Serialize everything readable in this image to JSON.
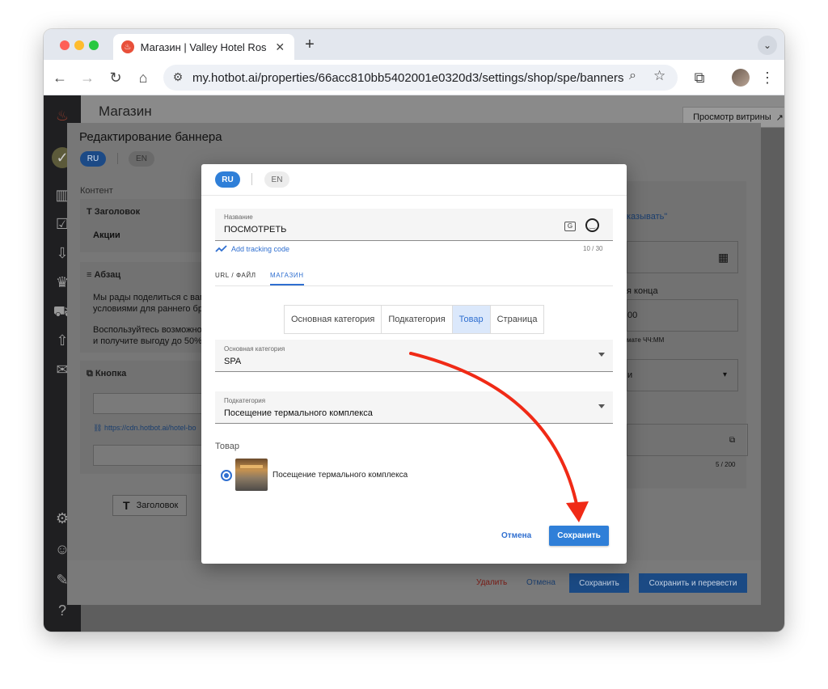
{
  "browser": {
    "tab_title": "Магазин | Valley Hotel Rosa K",
    "new_tab": "+",
    "url": "my.hotbot.ai/properties/66acc810bb5402001e0320d3/settings/shop/spe/banners"
  },
  "background_page": {
    "title": "Магазин",
    "showcase_button": "Просмотр витрины",
    "edit_panel": {
      "title": "Редактирование баннера",
      "lang_ru": "RU",
      "lang_en": "EN",
      "content_label": "Контент",
      "heading_card": {
        "label": "Заголовок",
        "value": "Акции"
      },
      "paragraph_card": {
        "label": "Абзац",
        "lines": [
          "Мы рады поделиться с вам",
          "условиями для раннего бр",
          "",
          "Воспользуйтесь возможно",
          "и получите выгоду до 50%"
        ]
      },
      "button_card": {
        "label": "Кнопка",
        "link": "https://cdn.hotbot.ai/hotel-bo"
      },
      "add_heading_chip": "Заголовок",
      "right_card": {
        "link_text": "казывать\"",
        "end_label": "я конца",
        "time_value": "00",
        "time_hint": "мате ЧЧ:ММ",
        "select_value": "и",
        "counter": "5 / 200"
      },
      "footer": {
        "delete": "Удалить",
        "cancel": "Отмена",
        "save": "Сохранить",
        "save_translate": "Сохранить и перевести"
      }
    }
  },
  "modal": {
    "lang_ru": "RU",
    "lang_en": "EN",
    "name_field": {
      "label": "Название",
      "value": "ПОСМОТРЕТЬ",
      "counter": "10 / 30"
    },
    "tracking_link": "Add tracking code",
    "tabs": [
      "URL / ФАЙЛ",
      "МАГАЗИН"
    ],
    "active_tab": "МАГАЗИН",
    "segments": [
      "Основная категория",
      "Подкатегория",
      "Товар",
      "Страница"
    ],
    "active_segment": "Товар",
    "main_category": {
      "label": "Основная категория",
      "value": "SPA"
    },
    "subcategory": {
      "label": "Подкатегория",
      "value": "Посещение термального комплекса"
    },
    "product_heading": "Товар",
    "product_name": "Посещение термального комплекса",
    "cancel": "Отмена",
    "save": "Сохранить"
  },
  "colors": {
    "accent": "#2f7fd8",
    "annotation_arrow": "#f02a16",
    "delete": "#c0392b"
  }
}
